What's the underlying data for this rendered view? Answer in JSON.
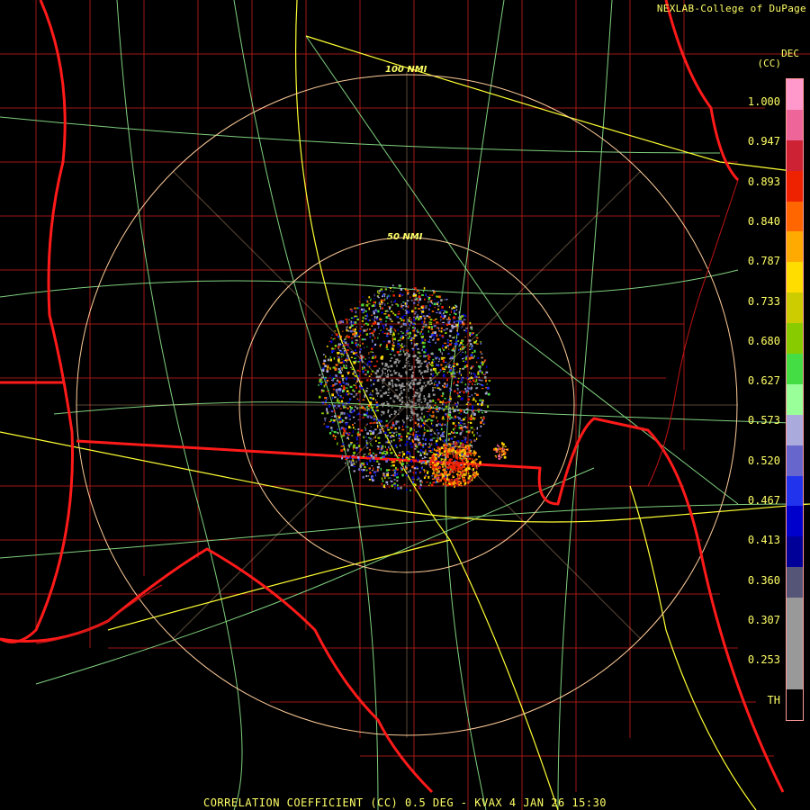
{
  "header": {
    "brand": "NEXLAB-College of DuPage",
    "unit_top": "DEC",
    "unit_sub": "(CC)"
  },
  "footer": {
    "caption": "CORRELATION COEFFICIENT (CC) 0.5 DEG - KVAX 4 JAN 26 15:30"
  },
  "range_rings": [
    {
      "label": "100 NMI"
    },
    {
      "label": "50 NMI"
    }
  ],
  "colorbar": {
    "labels": [
      "1.000",
      "0.947",
      "0.893",
      "0.840",
      "0.787",
      "0.733",
      "0.680",
      "0.627",
      "0.573",
      "0.520",
      "0.467",
      "0.413",
      "0.360",
      "0.307",
      "0.253",
      "TH"
    ],
    "colors": [
      "#ff99cc",
      "#ee6699",
      "#cc2233",
      "#ee2200",
      "#ff6600",
      "#ffaa00",
      "#ffdd00",
      "#cccc00",
      "#88cc00",
      "#44dd44",
      "#99ff99",
      "#aaaadd",
      "#6666cc",
      "#2233ee",
      "#0000cc",
      "#000099",
      "#555577",
      "#999999",
      "#999999",
      "#999999",
      "#000000"
    ]
  },
  "colors": {
    "state_border": "#ff1a1a",
    "county_border": "#b02020",
    "highway": "#ffff33",
    "road": "#88dd88",
    "ring": "#ffcc99",
    "label": "#ffff66"
  }
}
